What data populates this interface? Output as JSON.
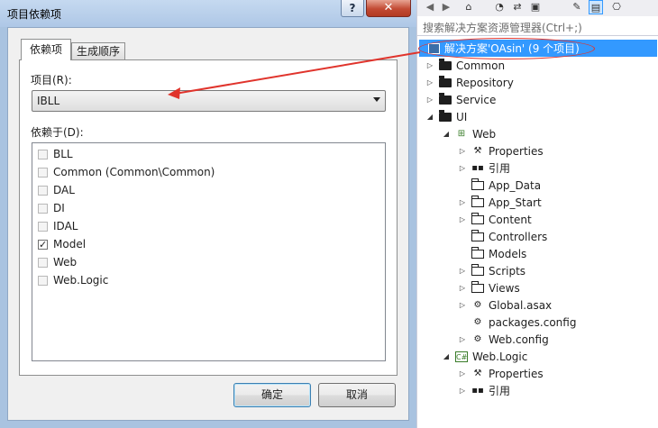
{
  "dialog": {
    "title": "项目依赖项",
    "help_glyph": "?",
    "close_glyph": "✕",
    "tabs": [
      {
        "label": "依赖项"
      },
      {
        "label": "生成顺序"
      }
    ],
    "project_label": "项目(R):",
    "project_value": "IBLL",
    "depends_label": "依赖于(D):",
    "dependencies": [
      {
        "label": "BLL",
        "checked": false
      },
      {
        "label": "Common (Common\\Common)",
        "checked": false
      },
      {
        "label": "DAL",
        "checked": false
      },
      {
        "label": "DI",
        "checked": false
      },
      {
        "label": "IDAL",
        "checked": false
      },
      {
        "label": "Model",
        "checked": true
      },
      {
        "label": "Web",
        "checked": false
      },
      {
        "label": "Web.Logic",
        "checked": false
      }
    ],
    "ok_label": "确定",
    "cancel_label": "取消"
  },
  "explorer": {
    "search_placeholder": "搜索解决方案资源管理器(Ctrl+;)",
    "solution_label": "解决方案'OAsin' (9 个项目)",
    "tree": [
      {
        "label": "Common",
        "icon": "folder-icon",
        "expander": "collapsed"
      },
      {
        "label": "Repository",
        "icon": "folder-icon",
        "expander": "collapsed"
      },
      {
        "label": "Service",
        "icon": "folder-icon",
        "expander": "collapsed"
      },
      {
        "label": "UI",
        "icon": "folder-open-icon",
        "expander": "expanded"
      },
      {
        "label": "Web",
        "icon": "web-project-icon",
        "expander": "expanded"
      },
      {
        "label": "Properties",
        "icon": "wrench-icon",
        "expander": "collapsed"
      },
      {
        "label": "引用",
        "icon": "references-icon",
        "expander": "collapsed"
      },
      {
        "label": "App_Data",
        "icon": "folder-outline-icon",
        "expander": "none"
      },
      {
        "label": "App_Start",
        "icon": "folder-outline-icon",
        "expander": "collapsed"
      },
      {
        "label": "Content",
        "icon": "folder-outline-icon",
        "expander": "collapsed"
      },
      {
        "label": "Controllers",
        "icon": "folder-outline-icon",
        "expander": "none"
      },
      {
        "label": "Models",
        "icon": "folder-outline-icon",
        "expander": "none"
      },
      {
        "label": "Scripts",
        "icon": "folder-outline-icon",
        "expander": "collapsed"
      },
      {
        "label": "Views",
        "icon": "folder-outline-icon",
        "expander": "collapsed"
      },
      {
        "label": "Global.asax",
        "icon": "global-asax-icon",
        "expander": "collapsed"
      },
      {
        "label": "packages.config",
        "icon": "config-icon",
        "expander": "none"
      },
      {
        "label": "Web.config",
        "icon": "config-icon",
        "expander": "collapsed"
      },
      {
        "label": "Web.Logic",
        "icon": "csharp-project-icon",
        "expander": "expanded"
      },
      {
        "label": "Properties",
        "icon": "wrench-icon",
        "expander": "collapsed"
      },
      {
        "label": "引用",
        "icon": "references-icon",
        "expander": "collapsed"
      }
    ]
  },
  "colors": {
    "selection": "#3399ff",
    "annotation": "#e0342c"
  }
}
